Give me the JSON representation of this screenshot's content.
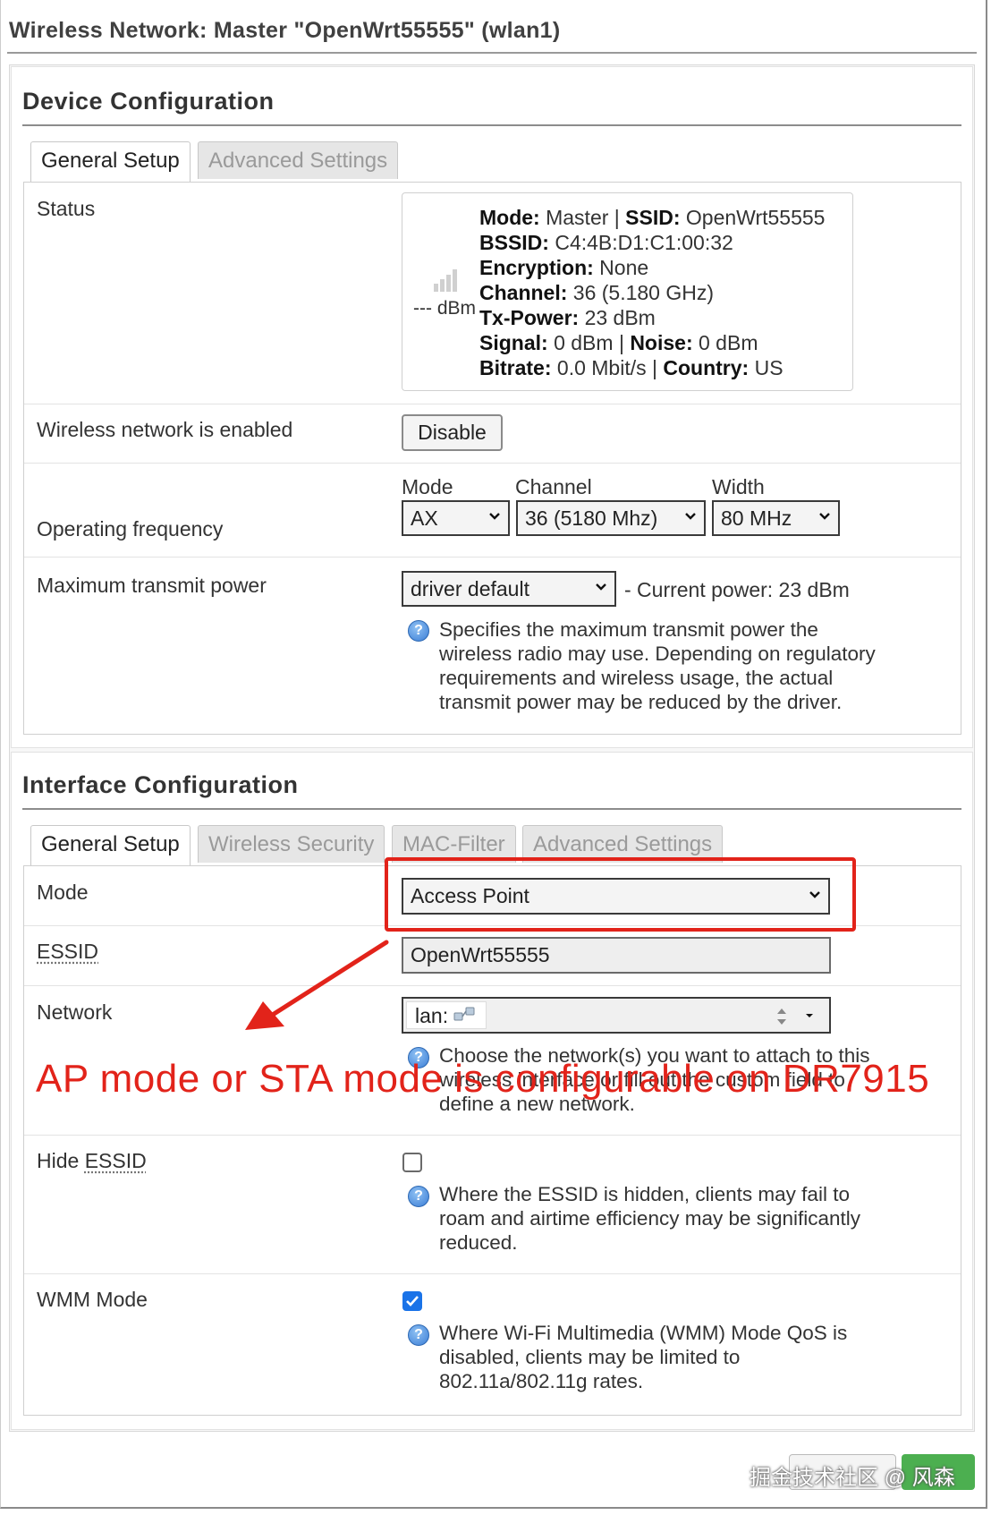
{
  "window": {
    "title": "Wireless Network: Master \"OpenWrt55555\" (wlan1)"
  },
  "device_config": {
    "heading": "Device Configuration",
    "tabs": [
      "General Setup",
      "Advanced Settings"
    ],
    "status": {
      "label": "Status",
      "dbm": "--- dBm",
      "mode_key": "Mode:",
      "mode_val": "Master",
      "ssid_key": "SSID:",
      "ssid_val": "OpenWrt55555",
      "bssid_key": "BSSID:",
      "bssid_val": "C4:4B:D1:C1:00:32",
      "enc_key": "Encryption:",
      "enc_val": "None",
      "channel_key": "Channel:",
      "channel_val": "36 (5.180 GHz)",
      "txpower_key": "Tx-Power:",
      "txpower_val": "23 dBm",
      "signal_key": "Signal:",
      "signal_val": "0 dBm",
      "noise_key": "Noise:",
      "noise_val": "0 dBm",
      "bitrate_key": "Bitrate:",
      "bitrate_val": "0.0 Mbit/s",
      "country_key": "Country:",
      "country_val": "US",
      "sep": "|"
    },
    "enabled": {
      "label": "Wireless network is enabled",
      "button": "Disable"
    },
    "frequency": {
      "label": "Operating frequency",
      "mode_header": "Mode",
      "mode_value": "AX",
      "channel_header": "Channel",
      "channel_value": "36 (5180 Mhz)",
      "width_header": "Width",
      "width_value": "80 MHz"
    },
    "txpower": {
      "label": "Maximum transmit power",
      "value": "driver default",
      "current": "- Current power: 23 dBm",
      "help": [
        "Specifies the maximum transmit power the",
        "wireless radio may use. Depending on regulatory",
        "requirements and wireless usage, the actual",
        "transmit power may be reduced by the driver."
      ]
    }
  },
  "interface_config": {
    "heading": "Interface Configuration",
    "tabs": [
      "General Setup",
      "Wireless Security",
      "MAC-Filter",
      "Advanced Settings"
    ],
    "mode": {
      "label": "Mode",
      "value": "Access Point"
    },
    "essid": {
      "label": "ESSID",
      "value": "OpenWrt55555"
    },
    "network": {
      "label": "Network",
      "value": "lan:",
      "help": [
        "Choose the network(s) you want to attach to this",
        "wireless interface or fill out the custom field to",
        "define a new network."
      ]
    },
    "hide_essid": {
      "label_prefix": "Hide ",
      "label_link": "ESSID",
      "checked": false,
      "help": [
        "Where the ESSID is hidden, clients may fail to",
        "roam and airtime efficiency may be significantly",
        "reduced."
      ]
    },
    "wmm": {
      "label": "WMM Mode",
      "checked": true,
      "help": [
        "Where Wi-Fi Multimedia (WMM) Mode QoS is",
        "disabled, clients may be limited to",
        "802.11a/802.11g rates."
      ]
    }
  },
  "annotation": {
    "text": "AP mode or STA mode is configurable on DR7915",
    "color": "#e2231a"
  },
  "watermark": {
    "text": "掘金技术社区 @ 风森"
  }
}
